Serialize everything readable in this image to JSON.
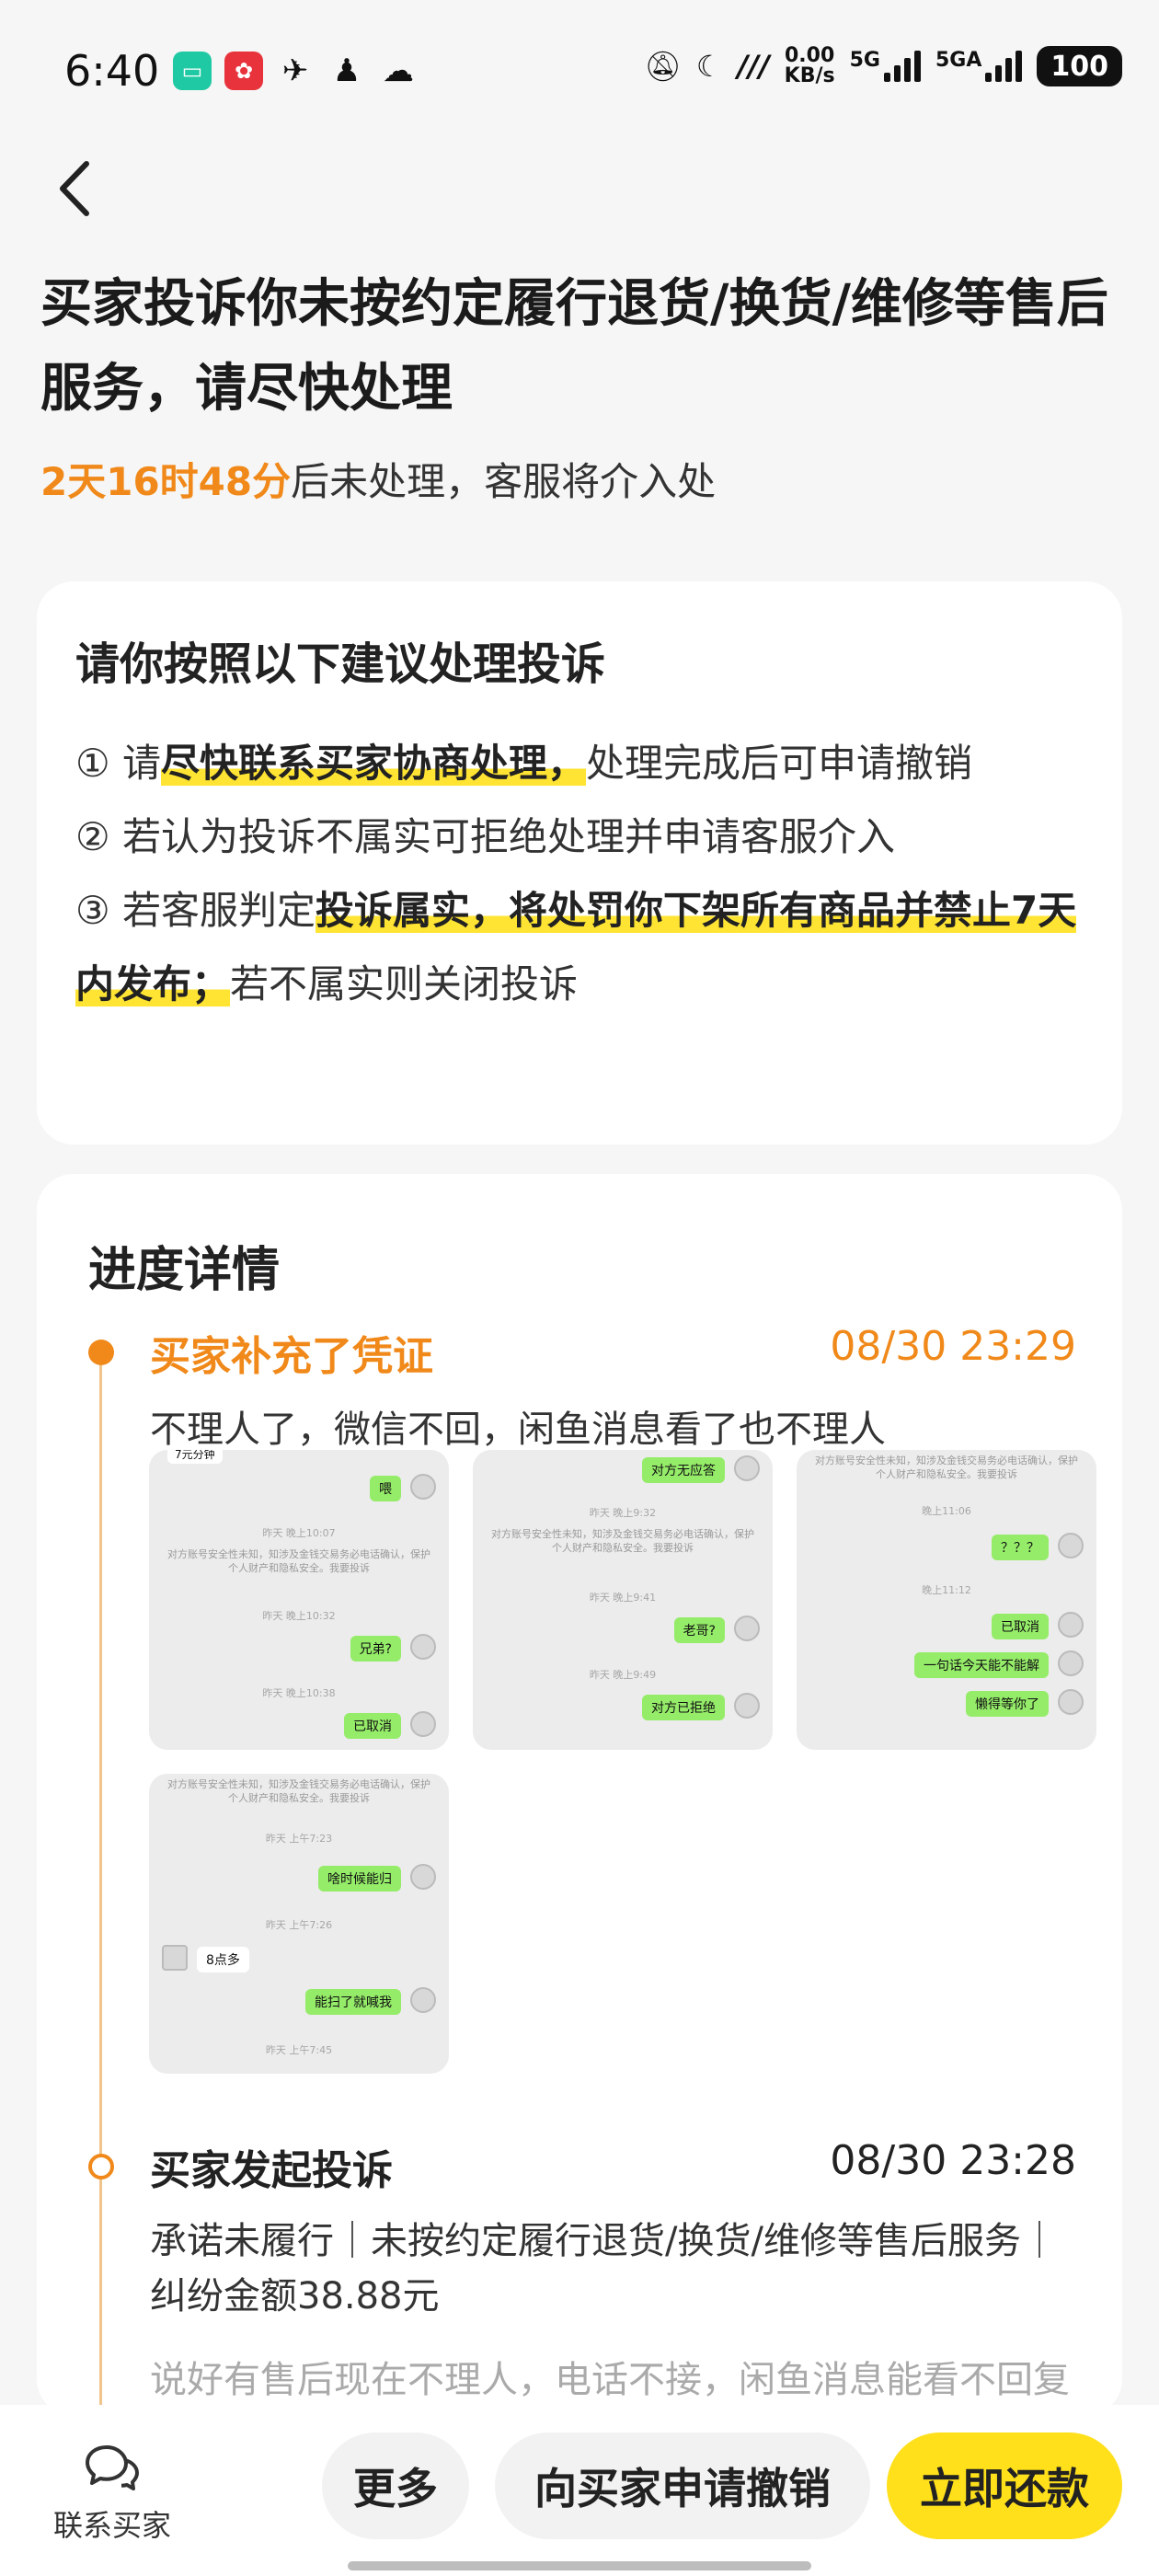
{
  "status_bar": {
    "time": "6:40",
    "net_speed_value": "0.00",
    "net_speed_unit": "KB/s",
    "sim1": "5G",
    "sim2": "5GA",
    "battery": "100"
  },
  "page": {
    "title": "买家投诉你未按约定履行退货/换货/维修等售后服务，请尽快处理",
    "deadline_highlight": "2天16时48分",
    "deadline_rest": "后未处理，客服将介入处"
  },
  "suggestions": {
    "heading": "请你按照以下建议处理投诉",
    "item1_prefix": "① 请",
    "item1_mark": "尽快联系买家协商处理，",
    "item1_suffix": "处理完成后可申请撤销",
    "item2": "② 若认为投诉不属实可拒绝处理并申请客服介入",
    "item3_prefix": "③ 若客服判定",
    "item3_mark": "投诉属实，将处罚你下架所有商品并禁止7天内发布；",
    "item3_suffix": "若不属实则关闭投诉"
  },
  "progress": {
    "heading": "进度详情",
    "events": [
      {
        "title": "买家补充了凭证",
        "time": "08/30 23:29",
        "desc": "不理人了，微信不回，闲鱼消息看了也不理人"
      },
      {
        "title": "买家发起投诉",
        "time": "08/30 23:28",
        "desc": "承诺未履行｜未按约定履行退货/换货/维修等售后服务｜纠纷金额38.88元",
        "note": "说好有售后现在不理人，电话不接，闲鱼消息能看不回复"
      }
    ],
    "screenshots": {
      "s1": {
        "top": "7元分钟",
        "b1": "喂",
        "t1": "昨天 晚上10:07",
        "sys": "对方账号安全性未知，知涉及金钱交易务必电话确认，保护个人财产和隐私安全。我要投诉",
        "t2": "昨天 晚上10:32",
        "b2": "兄弟?",
        "t3": "昨天 晚上10:38",
        "b3": "已取消"
      },
      "s2": {
        "b1": "对方无应答",
        "t1": "昨天 晚上9:32",
        "sys": "对方账号安全性未知，知涉及金钱交易务必电话确认，保护个人财产和隐私安全。我要投诉",
        "t2": "昨天 晚上9:41",
        "b2": "老哥?",
        "t3": "昨天 晚上9:49",
        "b3": "对方已拒绝"
      },
      "s3": {
        "sys": "对方账号安全性未知，知涉及金钱交易务必电话确认，保护个人财产和隐私安全。我要投诉",
        "t1": "晚上11:06",
        "b1": "？？？",
        "t2": "晚上11:12",
        "b2": "已取消",
        "b3": "一句话今天能不能解",
        "b4": "懒得等你了"
      },
      "s4": {
        "sys": "对方账号安全性未知，知涉及金钱交易务必电话确认，保护个人财产和隐私安全。我要投诉",
        "t1": "昨天 上午7:23",
        "b1": "啥时候能归",
        "t2": "昨天 上午7:26",
        "w1": "8点多",
        "b2": "能扫了就喊我",
        "t3": "昨天 上午7:45"
      }
    }
  },
  "bottom_bar": {
    "contact_label": "联系买家",
    "more_label": "更多",
    "revoke_label": "向买家申请撤销",
    "pay_label": "立即还款"
  },
  "colors": {
    "accent_orange": "#f0891a",
    "highlight_yellow": "#ffe433",
    "pay_button": "#ffe01b",
    "chat_bubble_green": "#95ec69"
  }
}
